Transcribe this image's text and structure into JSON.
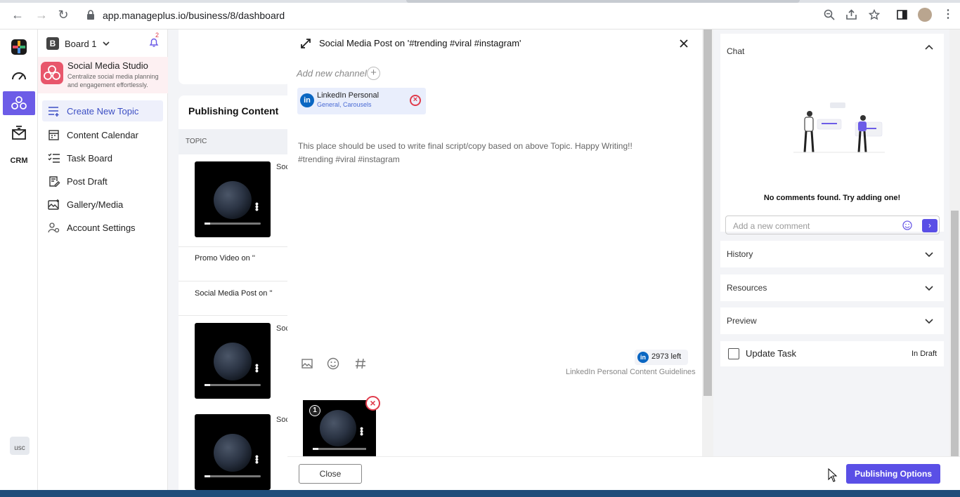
{
  "browser": {
    "url": "app.manageplus.io/business/8/dashboard"
  },
  "sidebar": {
    "board_name": "Board 1",
    "notification_count": "2",
    "studio_name": "Social Media Studio",
    "studio_desc": "Centralize social media planning and engagement effortlessly.",
    "studio_logo_color": "#e8566b",
    "items": [
      {
        "label": "Create New Topic",
        "icon": "create-topic-icon"
      },
      {
        "label": "Content Calendar",
        "icon": "calendar-icon"
      },
      {
        "label": "Task Board",
        "icon": "task-list-icon"
      },
      {
        "label": "Post Draft",
        "icon": "draft-icon"
      },
      {
        "label": "Gallery/Media",
        "icon": "gallery-icon"
      },
      {
        "label": "Account Settings",
        "icon": "account-settings-icon"
      }
    ],
    "rail_crm": "CRM",
    "avatar_alt": "usc"
  },
  "content": {
    "title": "Publishing Content",
    "column": "TOPIC",
    "soc_label": "Soc",
    "rows": [
      "Promo Video on ''",
      "Social Media Post on ''"
    ]
  },
  "modal": {
    "title": "Social Media Post on '#trending #viral #instagram'",
    "add_channel": "Add new channel",
    "channel": {
      "name": "LinkedIn Personal",
      "sub": "General, Carousels",
      "icon": "in"
    },
    "body_line1": "This place should be used to write final script/copy based on above Topic. Happy Writing!!",
    "body_line2": "#trending #viral #instagram",
    "chars_left": "2973 left",
    "guidelines": "LinkedIn Personal Content Guidelines",
    "media_index": "1",
    "close": "Close",
    "accent": "#5a4fe6",
    "danger": "#e03b4b"
  },
  "right": {
    "chat": "Chat",
    "no_comments": "No comments found. Try adding one!",
    "comment_placeholder": "Add a new comment",
    "history": "History",
    "resources": "Resources",
    "preview": "Preview",
    "update_task": "Update Task",
    "status": "In Draft",
    "publishing": "Publishing Options"
  }
}
